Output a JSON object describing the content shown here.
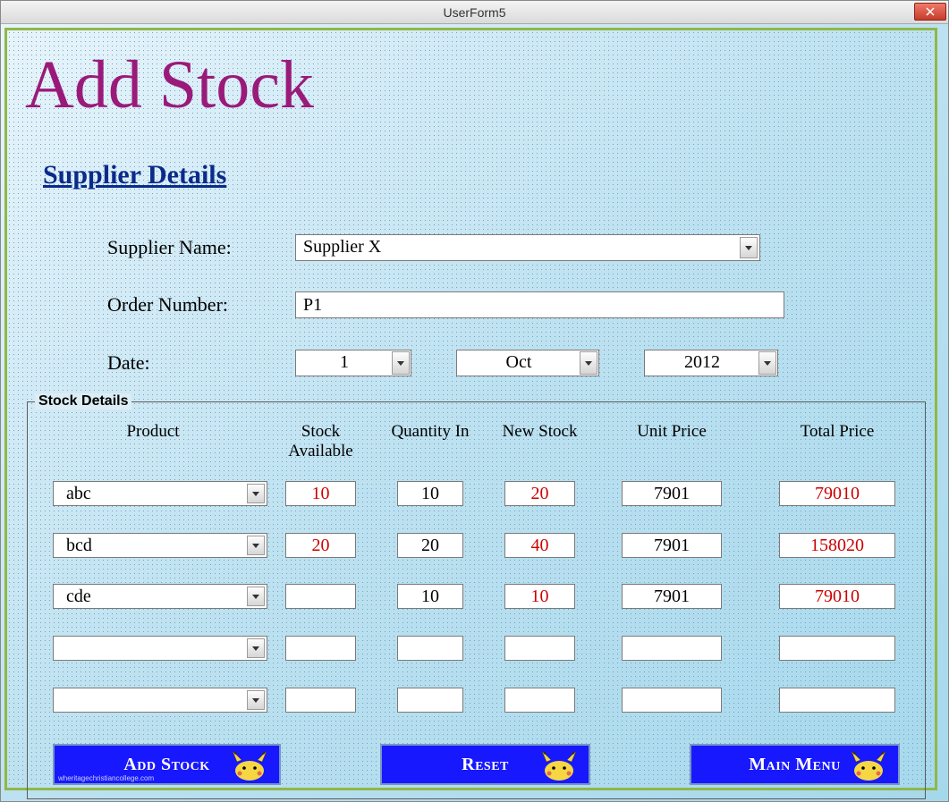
{
  "window": {
    "title": "UserForm5"
  },
  "heading": "Add Stock",
  "section_title": "Supplier Details",
  "supplier": {
    "name_label": "Supplier Name:",
    "name_value": "Supplier X",
    "order_label": "Order Number:",
    "order_value": "P1",
    "date_label": "Date:",
    "date_day": "1",
    "date_month": "Oct",
    "date_year": "2012"
  },
  "stock": {
    "legend": "Stock Details",
    "headers": {
      "product": "Product",
      "available": "Stock Available",
      "qty_in": "Quantity In",
      "new_stock": "New Stock",
      "unit_price": "Unit Price",
      "total_price": "Total Price"
    },
    "rows": [
      {
        "product": "abc",
        "available": "10",
        "qty_in": "10",
        "new_stock": "20",
        "unit_price": "7901",
        "total_price": "79010"
      },
      {
        "product": "bcd",
        "available": "20",
        "qty_in": "20",
        "new_stock": "40",
        "unit_price": "7901",
        "total_price": "158020"
      },
      {
        "product": "cde",
        "available": "",
        "qty_in": "10",
        "new_stock": "10",
        "unit_price": "7901",
        "total_price": "79010"
      },
      {
        "product": "",
        "available": "",
        "qty_in": "",
        "new_stock": "",
        "unit_price": "",
        "total_price": ""
      },
      {
        "product": "",
        "available": "",
        "qty_in": "",
        "new_stock": "",
        "unit_price": "",
        "total_price": ""
      }
    ]
  },
  "buttons": {
    "add_stock": "Add Stock",
    "reset": "Reset",
    "main_menu": "Main Menu"
  },
  "watermark": "wheritagechristiancollege.com"
}
